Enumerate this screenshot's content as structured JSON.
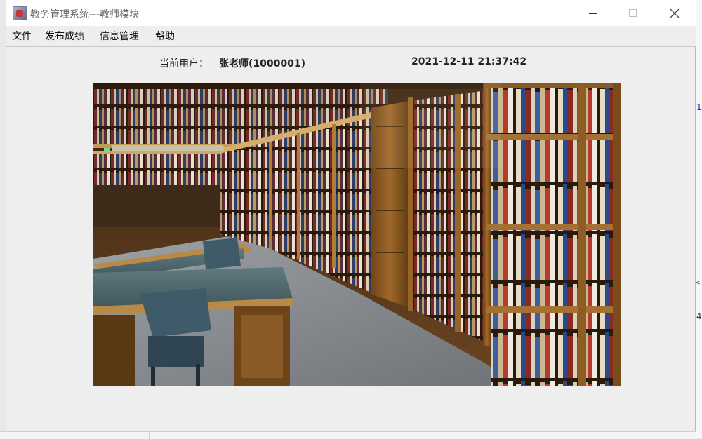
{
  "window": {
    "title": "教务管理系统---教师模块"
  },
  "menubar": {
    "items": [
      {
        "label": "文件"
      },
      {
        "label": "发布成绩"
      },
      {
        "label": "信息管理"
      },
      {
        "label": "帮助"
      }
    ]
  },
  "status": {
    "user_label": "当前用户：",
    "user_name": "张老师(1000001)",
    "datetime": "2021-12-11 21:37:42"
  },
  "background": {
    "glyph_1": "1",
    "glyph_2": "<",
    "glyph_3": "4"
  },
  "colors": {
    "window_bg": "#eeeeee",
    "titlebar_bg": "#ffffff",
    "shelf_wood": "#8a5a24",
    "carpet": "#8a8e93"
  },
  "banner": {
    "icon": "library-bookshelves-photo"
  }
}
